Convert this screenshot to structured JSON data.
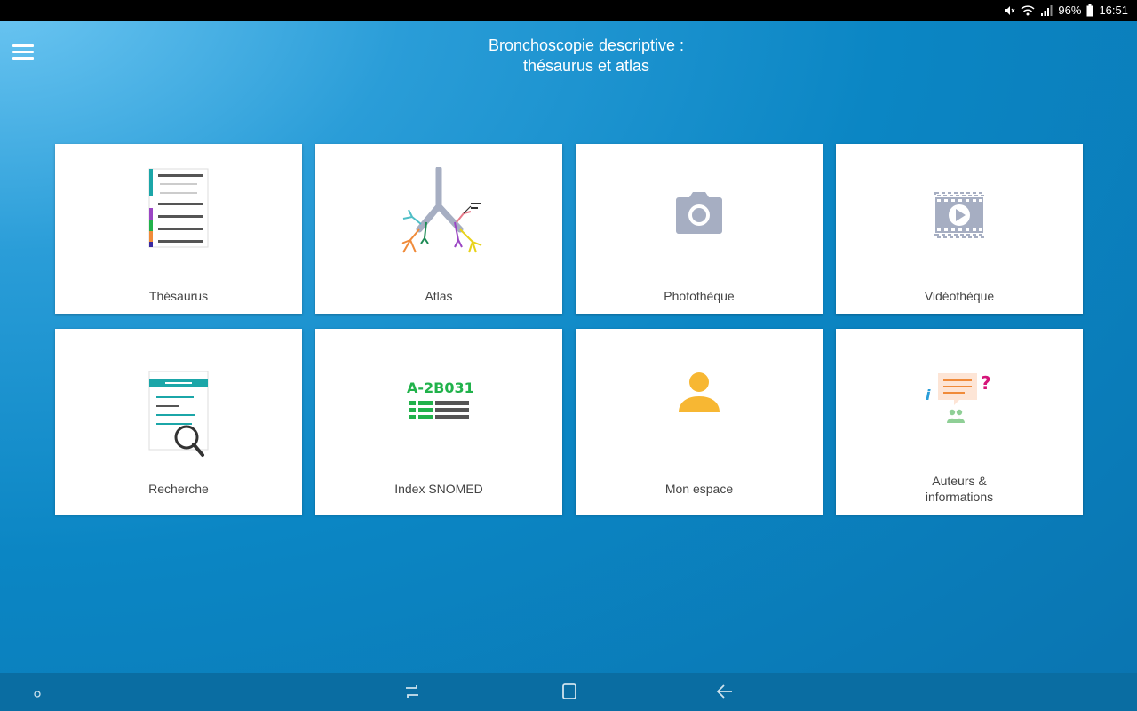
{
  "status": {
    "battery": "96%",
    "time": "16:51"
  },
  "header": {
    "title_line1": "Bronchoscopie descriptive :",
    "title_line2": "thésaurus et atlas"
  },
  "tiles": [
    {
      "label": "Thésaurus"
    },
    {
      "label": "Atlas"
    },
    {
      "label": "Photothèque"
    },
    {
      "label": "Vidéothèque"
    },
    {
      "label": "Recherche"
    },
    {
      "label": "Index SNOMED",
      "icon_text": "A-2B031"
    },
    {
      "label": "Mon espace"
    },
    {
      "label_line1": "Auteurs &",
      "label_line2": "informations"
    }
  ],
  "colors": {
    "accent_green": "#21b24b",
    "icon_gray": "#a6aec2",
    "person_orange": "#f7b733"
  }
}
